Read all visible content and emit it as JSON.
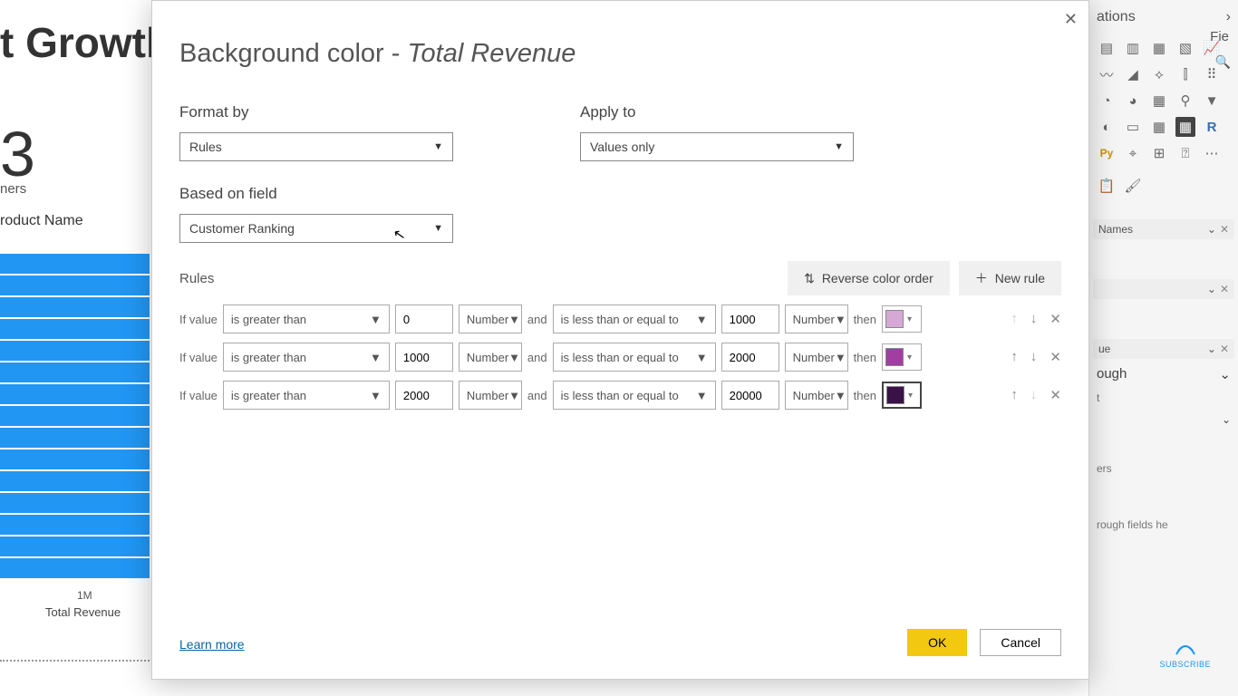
{
  "bg": {
    "title": "t Growtl",
    "number": "3",
    "sub": "ners",
    "col_header": "roduct Name",
    "xaxis_tick": "1M",
    "xaxis_label": "Total Revenue"
  },
  "viz": {
    "header": "ations",
    "fields": "Fie",
    "field1": "Names",
    "field3": "ue",
    "section": "ough",
    "item_t": "t",
    "item_ers": "ers",
    "drill": "rough fields he"
  },
  "modal": {
    "title_prefix": "Background color - ",
    "title_measure": "Total Revenue",
    "format_by_label": "Format by",
    "format_by_value": "Rules",
    "apply_to_label": "Apply to",
    "apply_to_value": "Values only",
    "based_on_label": "Based on field",
    "based_on_value": "Customer Ranking",
    "rules_label": "Rules",
    "reverse_btn": "Reverse color order",
    "new_rule_btn": "New rule",
    "if_value": "If value",
    "and": "and",
    "then": "then",
    "learn_more": "Learn more",
    "ok": "OK",
    "cancel": "Cancel"
  },
  "rules": [
    {
      "op1": "is greater than",
      "v1": "0",
      "t1": "Number",
      "op2": "is less than or equal to",
      "v2": "1000",
      "t2": "Number",
      "color": "#d6a8d6"
    },
    {
      "op1": "is greater than",
      "v1": "1000",
      "t1": "Number",
      "op2": "is less than or equal to",
      "v2": "2000",
      "t2": "Number",
      "color": "#a23ea2"
    },
    {
      "op1": "is greater than",
      "v1": "2000",
      "t1": "Number",
      "op2": "is less than or equal to",
      "v2": "20000",
      "t2": "Number",
      "color": "#3a1248"
    }
  ],
  "subscribe": "SUBSCRIBE"
}
